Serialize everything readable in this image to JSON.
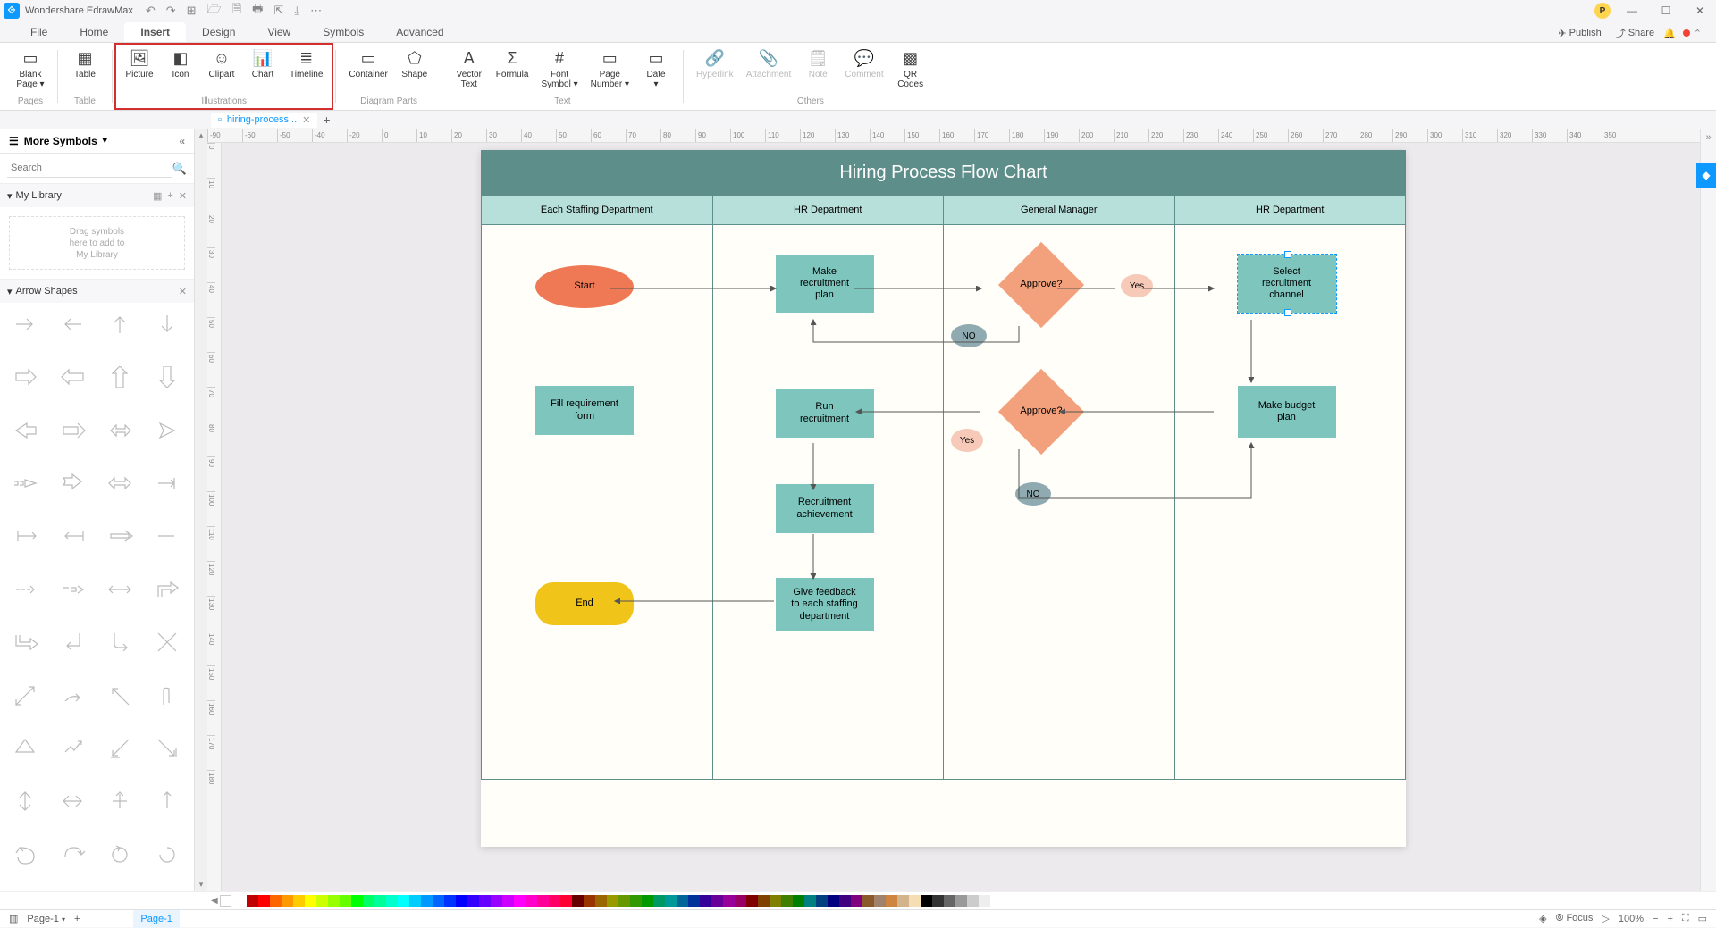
{
  "app": {
    "title": "Wondershare EdrawMax"
  },
  "titlebar_tools": [
    "↶",
    "↷",
    "⊞",
    "🗁",
    "🗎",
    "🖶",
    "⇱",
    "⤓",
    "⋯"
  ],
  "window_controls": {
    "min": "—",
    "max": "☐",
    "close": "✕"
  },
  "avatar_initial": "P",
  "menus": [
    "File",
    "Home",
    "Insert",
    "Design",
    "View",
    "Symbols",
    "Advanced"
  ],
  "active_menu": "Insert",
  "menu_right": {
    "publish": "Publish",
    "share": "Share"
  },
  "ribbon": {
    "groups": [
      {
        "label": "Pages",
        "items": [
          {
            "label": "Blank\nPage ▾",
            "icon": "▭"
          }
        ]
      },
      {
        "label": "Table",
        "items": [
          {
            "label": "Table",
            "icon": "▦"
          }
        ]
      },
      {
        "label": "Illustrations",
        "highlight": true,
        "items": [
          {
            "label": "Picture",
            "icon": "🖼"
          },
          {
            "label": "Icon",
            "icon": "◧"
          },
          {
            "label": "Clipart",
            "icon": "☺"
          },
          {
            "label": "Chart",
            "icon": "📊"
          },
          {
            "label": "Timeline",
            "icon": "≣"
          }
        ]
      },
      {
        "label": "Diagram Parts",
        "items": [
          {
            "label": "Container",
            "icon": "▭"
          },
          {
            "label": "Shape",
            "icon": "⬠"
          }
        ]
      },
      {
        "label": "Text",
        "items": [
          {
            "label": "Vector\nText",
            "icon": "A"
          },
          {
            "label": "Formula",
            "icon": "Σ"
          },
          {
            "label": "Font\nSymbol ▾",
            "icon": "#"
          },
          {
            "label": "Page\nNumber ▾",
            "icon": "▭"
          },
          {
            "label": "Date\n▾",
            "icon": "▭"
          }
        ]
      },
      {
        "label": "Others",
        "items": [
          {
            "label": "Hyperlink",
            "icon": "🔗",
            "disabled": true
          },
          {
            "label": "Attachment",
            "icon": "📎",
            "disabled": true
          },
          {
            "label": "Note",
            "icon": "🗒",
            "disabled": true
          },
          {
            "label": "Comment",
            "icon": "💬",
            "disabled": true
          },
          {
            "label": "QR\nCodes",
            "icon": "▩"
          }
        ]
      }
    ]
  },
  "doc_tab": {
    "name": "hiring-process...",
    "close": "✕"
  },
  "ruler_ticks": [
    "-90",
    "-60",
    "-50",
    "-40",
    "-20",
    "0",
    "10",
    "20",
    "30",
    "40",
    "50",
    "60",
    "70",
    "80",
    "90",
    "100",
    "110",
    "120",
    "130",
    "140",
    "150",
    "160",
    "170",
    "180",
    "190",
    "200",
    "210",
    "220",
    "230",
    "240",
    "250",
    "260",
    "270",
    "280",
    "290",
    "300",
    "310",
    "320",
    "330",
    "340",
    "350"
  ],
  "ruler_v_ticks": [
    "0",
    "10",
    "20",
    "30",
    "40",
    "50",
    "60",
    "70",
    "80",
    "90",
    "100",
    "110",
    "120",
    "130",
    "140",
    "150",
    "160",
    "170",
    "180"
  ],
  "sidebar": {
    "title": "More Symbols",
    "search_placeholder": "Search",
    "my_library": "My Library",
    "drop_hint": "Drag symbols\nhere to add to\nMy Library",
    "arrow_shapes": "Arrow Shapes"
  },
  "flowchart": {
    "title": "Hiring Process Flow Chart",
    "lanes": [
      "Each Staffing Department",
      "HR Department",
      "General Manager",
      "HR Department"
    ],
    "nodes": {
      "start": "Start",
      "fill": "Fill requirement\nform",
      "end": "End",
      "make_plan": "Make\nrecruitment\nplan",
      "run": "Run\nrecruitment",
      "achievement": "Recruitment\nachievement",
      "feedback": "Give feedback\nto each staffing\ndepartment",
      "approve1": "Approve?",
      "approve2": "Approve?",
      "yes": "Yes",
      "no": "NO",
      "select": "Select\nrecruitment\nchannel",
      "budget": "Make budget\nplan"
    }
  },
  "statusbar": {
    "page_selector": "Page-1",
    "page_tab": "Page-1",
    "focus": "Focus",
    "zoom": "100%"
  },
  "color_swatches": [
    "#ffffff",
    "#c00000",
    "#ff0000",
    "#ff6600",
    "#ff9900",
    "#ffcc00",
    "#ffff00",
    "#ccff00",
    "#99ff00",
    "#66ff00",
    "#00ff00",
    "#00ff66",
    "#00ff99",
    "#00ffcc",
    "#00ffff",
    "#00ccff",
    "#0099ff",
    "#0066ff",
    "#0033ff",
    "#0000ff",
    "#3300ff",
    "#6600ff",
    "#9900ff",
    "#cc00ff",
    "#ff00ff",
    "#ff00cc",
    "#ff0099",
    "#ff0066",
    "#ff0033",
    "#660000",
    "#993300",
    "#996600",
    "#999900",
    "#669900",
    "#339900",
    "#009900",
    "#009966",
    "#009999",
    "#006699",
    "#003399",
    "#330099",
    "#660099",
    "#990099",
    "#990066",
    "#800000",
    "#804000",
    "#808000",
    "#408000",
    "#008000",
    "#008080",
    "#004080",
    "#000080",
    "#400080",
    "#800080",
    "#8b5a2b",
    "#a0826d",
    "#cd853f",
    "#d2b48c",
    "#f5deb3",
    "#000000",
    "#333333",
    "#666666",
    "#999999",
    "#cccccc",
    "#eeeeee"
  ]
}
